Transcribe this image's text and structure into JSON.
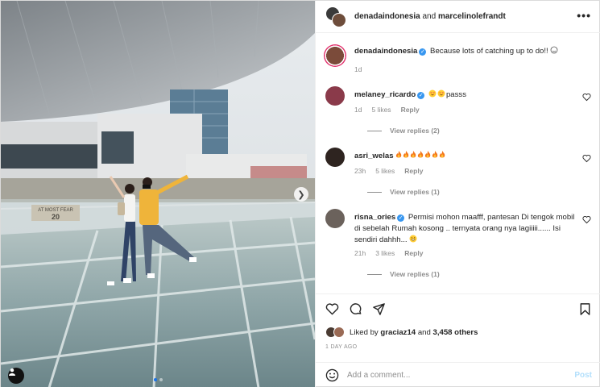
{
  "header": {
    "user1": "denadaindonesia",
    "joiner": "and",
    "user2": "marcelinolefrandt",
    "more_icon": "more-horizontal-icon"
  },
  "caption": {
    "username": "denadaindonesia",
    "text": "Because lots of catching up to do!!",
    "time": "1d"
  },
  "comments": [
    {
      "username": "melaney_ricardo",
      "verified": true,
      "text": "passs",
      "emoji": [
        "heart-eyes",
        "heart-eyes"
      ],
      "time": "1d",
      "likes": "5 likes",
      "reply": "Reply",
      "view_replies": "View replies (2)"
    },
    {
      "username": "asri_welas",
      "verified": false,
      "text": "",
      "emoji": [
        "fire",
        "fire",
        "fire",
        "fire",
        "fire",
        "fire",
        "fire"
      ],
      "time": "23h",
      "likes": "5 likes",
      "reply": "Reply",
      "view_replies": "View replies (1)"
    },
    {
      "username": "risna_ories",
      "verified": true,
      "text": "Permisi mohon maafff, pantesan Di tengok mobil di sebelah Rumah kosong .. ternyata orang nya lagiiiii...... Isi sendiri dahhh...",
      "emoji": [
        "grin"
      ],
      "time": "21h",
      "likes": "3 likes",
      "reply": "Reply",
      "view_replies": "View replies (1)"
    }
  ],
  "actions": {
    "like_icon": "heart-icon",
    "comment_icon": "comment-icon",
    "share_icon": "share-icon",
    "save_icon": "bookmark-icon"
  },
  "likes": {
    "prefix": "Liked by",
    "user": "graciaz14",
    "middle": "and",
    "count": "3,458 others"
  },
  "date": "1 DAY AGO",
  "comment_input": {
    "placeholder": "Add a comment...",
    "post_label": "Post"
  },
  "carousel": {
    "count": 2,
    "active": 0,
    "building_sign_top": "AT MOST FEAR",
    "building_sign_num": "20"
  },
  "colors": {
    "accent": "#3897f0",
    "post_disabled": "#b2dffc",
    "muted": "#8e8e8e"
  }
}
